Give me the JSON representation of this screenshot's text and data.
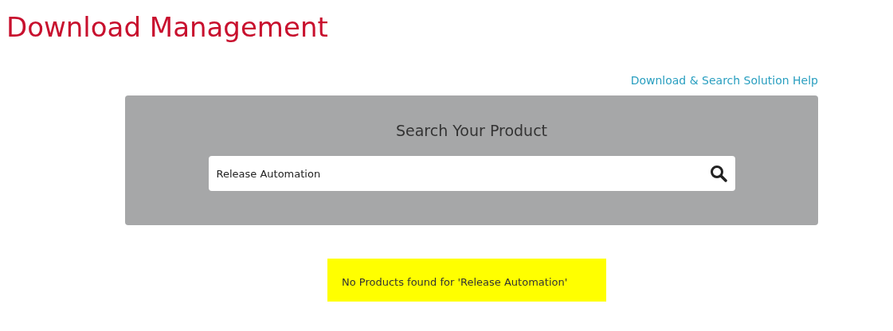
{
  "title": "Download Management",
  "help_link": "Download & Search Solution Help",
  "search": {
    "heading": "Search Your Product",
    "value": "Release Automation"
  },
  "message": "No Products found for 'Release Automation'"
}
